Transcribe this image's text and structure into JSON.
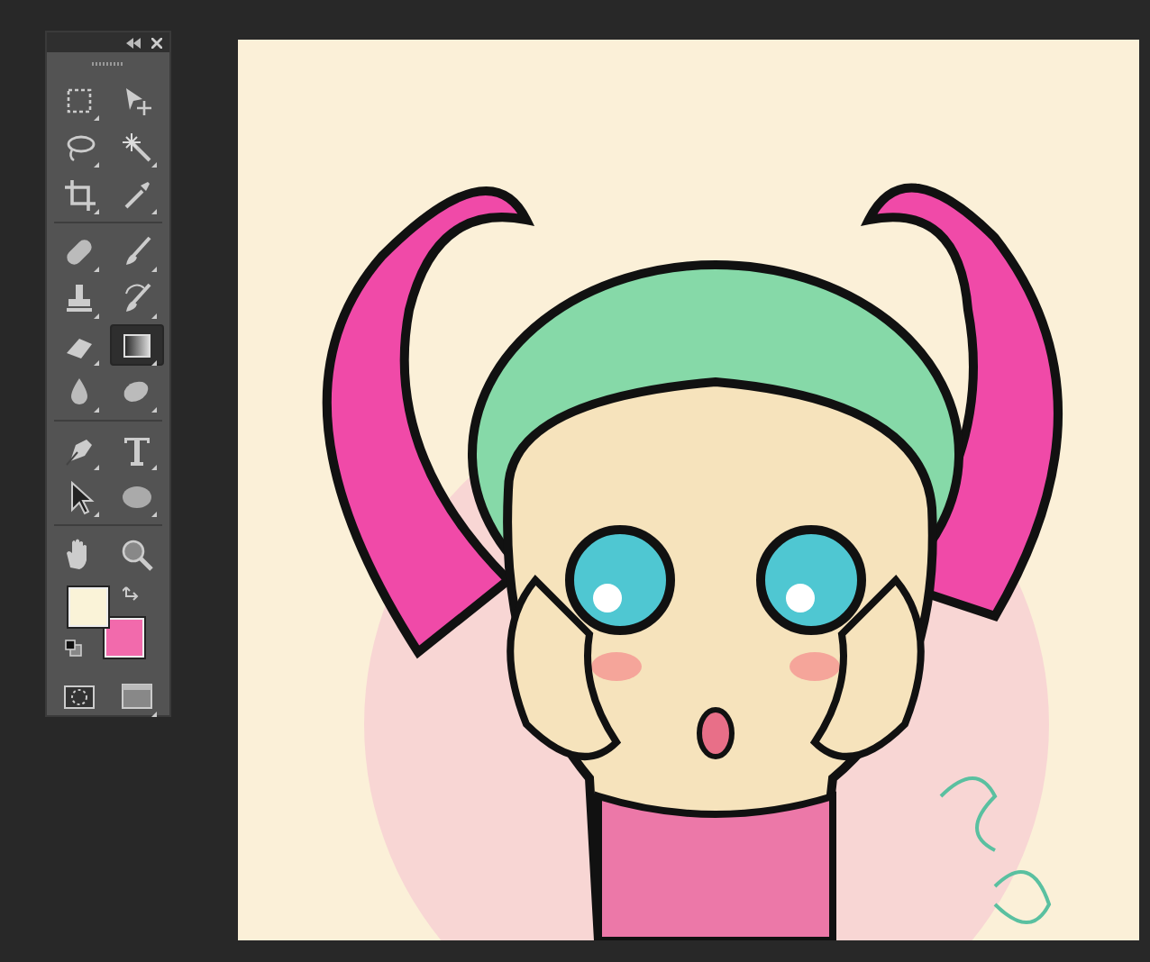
{
  "toolbox": {
    "tool_groups": [
      [
        {
          "kind": "marquee",
          "selected": false
        },
        {
          "kind": "move",
          "selected": false
        },
        {
          "kind": "lasso",
          "selected": false
        },
        {
          "kind": "wand",
          "selected": false
        },
        {
          "kind": "crop",
          "selected": false
        },
        {
          "kind": "eyedropper",
          "selected": false
        }
      ],
      [
        {
          "kind": "healing",
          "selected": false
        },
        {
          "kind": "brush",
          "selected": false
        },
        {
          "kind": "stamp",
          "selected": false
        },
        {
          "kind": "history",
          "selected": false
        },
        {
          "kind": "eraser",
          "selected": false
        },
        {
          "kind": "gradient",
          "selected": true
        },
        {
          "kind": "blur",
          "selected": false
        },
        {
          "kind": "smudge",
          "selected": false
        }
      ],
      [
        {
          "kind": "pen",
          "selected": false
        },
        {
          "kind": "type",
          "selected": false
        },
        {
          "kind": "select",
          "selected": false
        },
        {
          "kind": "ellipse",
          "selected": false
        }
      ],
      [
        {
          "kind": "hand",
          "selected": false
        },
        {
          "kind": "zoom",
          "selected": false
        }
      ]
    ],
    "swatches": [
      {
        "kind": "foreground",
        "color": "#faf3d8"
      },
      {
        "kind": "background",
        "color": "#f26aac"
      }
    ],
    "bottom_tools": [
      {
        "kind": "quickmask",
        "selected": false
      },
      {
        "kind": "screenmode",
        "selected": false
      }
    ]
  }
}
